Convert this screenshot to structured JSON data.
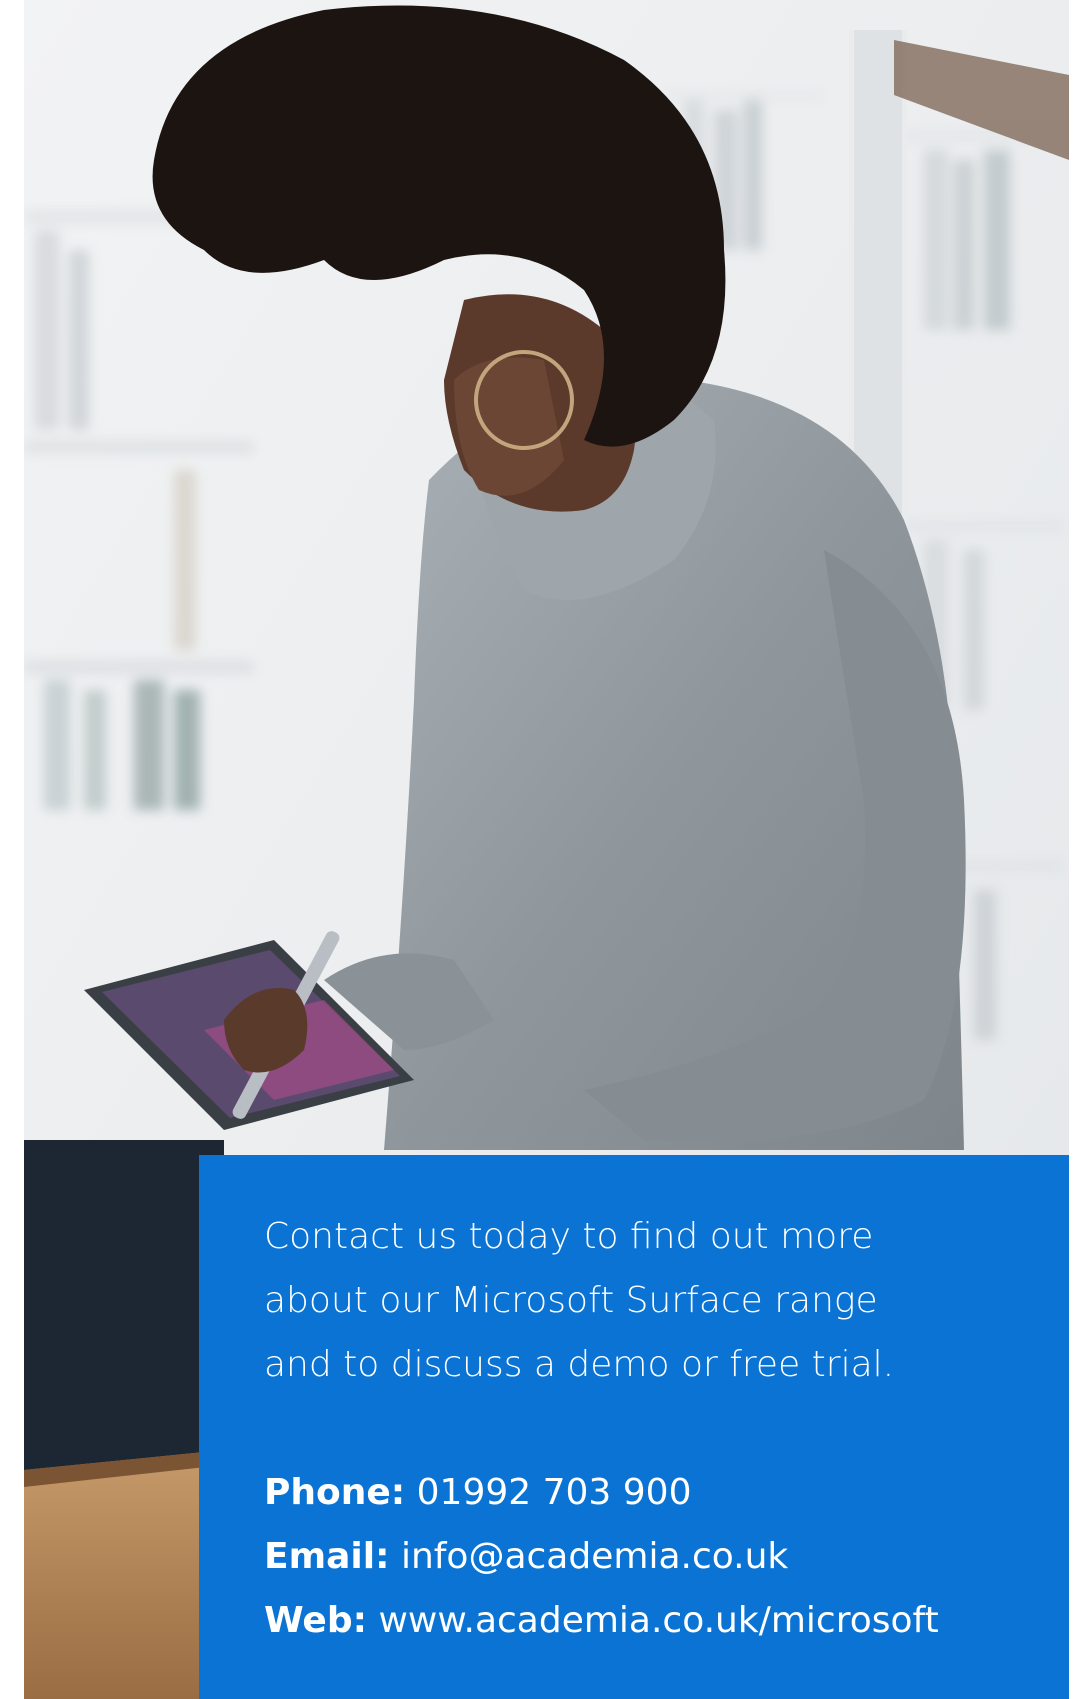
{
  "photo": {
    "alt": "Woman writing on a tablet with a stylus"
  },
  "cta": {
    "intro_lines": [
      "Contact us today to find out more",
      "about our Microsoft Surface range",
      "and to discuss a demo or free trial."
    ],
    "phone_label": "Phone:",
    "phone_value": "01992 703 900",
    "email_label": "Email:",
    "email_value": "info@academia.co.uk",
    "web_label": "Web:",
    "web_value": "www.academia.co.uk/microsoft"
  },
  "colors": {
    "panel": "#0a73d4",
    "text": "#ffffff"
  }
}
